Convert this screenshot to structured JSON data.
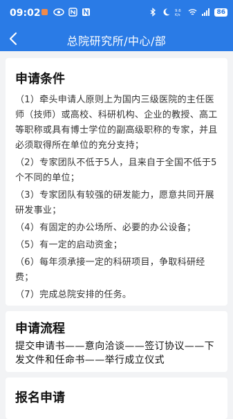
{
  "status_bar": {
    "time": "09:02",
    "battery": "86",
    "icons_left": [
      "notification-dot-icon",
      "eye-icon",
      "nfc-icon",
      "n-app-icon"
    ],
    "icons_right": [
      "bluetooth-icon",
      "moon-icon",
      "data-speed-icon",
      "wifi-icon",
      "signal-icon",
      "battery-icon"
    ],
    "accent_color": "#2a7be6"
  },
  "nav": {
    "title": "总院研究所/中心/部"
  },
  "conditions": {
    "title": "申请条件",
    "items": [
      "（1）牵头申请人原则上为国内三级医院的主任医师（技师）或高校、科研机构、企业的教授、高工等职称或具有博士学位的副高级职称的专家，并且必须取得所在单位的充分支持；",
      "（2）专家团队不低于5人，且来自于全国不低于5个不同的单位；",
      "（3）专家团队有较强的研发能力，愿意共同开展研发事业；",
      "（4）有固定的办公场所、必要的办公设备；",
      "（5）有一定的启动资金；",
      "（6）每年须承接一定的科研项目，争取科研经费；",
      "（7）完成总院安排的任务。"
    ]
  },
  "process": {
    "title": "申请流程",
    "text": "提交申请书——意向洽谈——签订协议——下发文件和任命书——举行成立仪式"
  },
  "signup": {
    "title": "报名申请"
  }
}
